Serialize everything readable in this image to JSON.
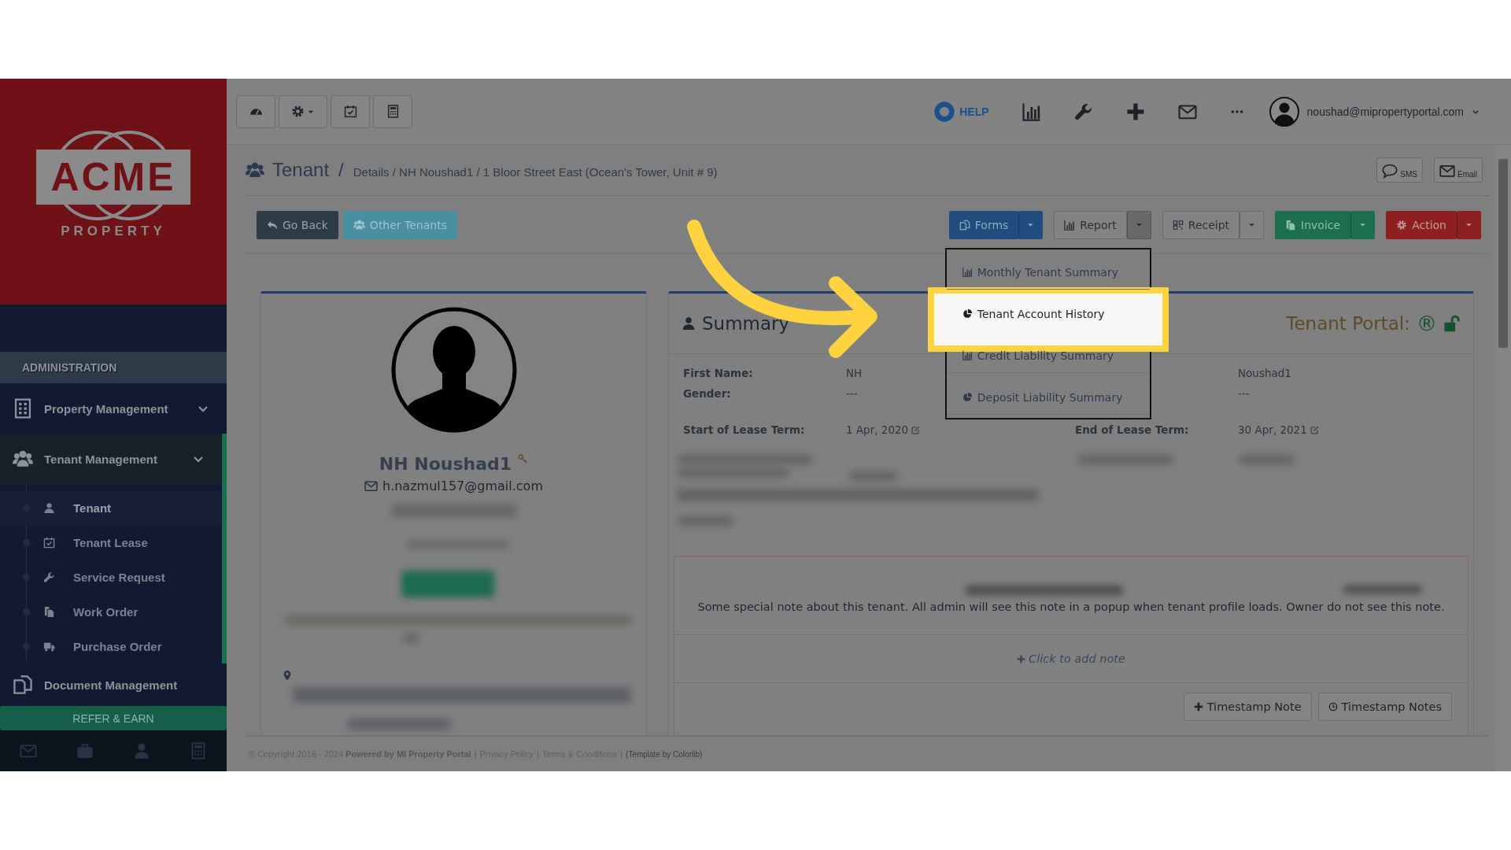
{
  "sidebar": {
    "logo": {
      "name": "ACME",
      "tagline": "PROPERTY"
    },
    "section": "ADMINISTRATION",
    "items": [
      {
        "label": "Property Management",
        "expanded": false
      },
      {
        "label": "Tenant Management",
        "expanded": true,
        "children": [
          {
            "label": "Tenant",
            "selected": true
          },
          {
            "label": "Tenant Lease",
            "selected": false
          },
          {
            "label": "Service Request",
            "selected": false
          },
          {
            "label": "Work Order",
            "selected": false
          },
          {
            "label": "Purchase Order",
            "selected": false
          }
        ]
      },
      {
        "label": "Document Management"
      }
    ],
    "refer": "REFER & EARN"
  },
  "topbar": {
    "help": "HELP",
    "user": "noushad@mipropertyportal.com"
  },
  "header": {
    "title": "Tenant",
    "separator": "/",
    "trail": "Details / NH Noushad1 / 1 Bloor Street East (Ocean's Tower, Unit # 9)",
    "contact_buttons": [
      "SMS",
      "Email"
    ]
  },
  "actions": {
    "left": [
      "Go Back",
      "Other Tenants"
    ],
    "right": [
      {
        "label": "Forms",
        "kind": "primary",
        "open": false
      },
      {
        "label": "Report",
        "kind": "default",
        "open": true
      },
      {
        "label": "Receipt",
        "kind": "default",
        "open": false
      },
      {
        "label": "Invoice",
        "kind": "success",
        "open": false
      },
      {
        "label": "Action",
        "kind": "danger",
        "open": false
      }
    ]
  },
  "report_menu": [
    {
      "label": "Monthly Tenant Summary",
      "selected": false
    },
    {
      "label": "Tenant Account History",
      "selected": true
    },
    {
      "label": "Credit Liability Summary",
      "selected": false
    },
    {
      "label": "Deposit Liability Summary",
      "selected": false
    }
  ],
  "profile": {
    "name": "NH Noushad1",
    "email": "h.nazmul157@gmail.com"
  },
  "summary": {
    "title": "Summary",
    "portal": "Tenant Portal:",
    "portal_mark": "®",
    "fields": [
      {
        "label": "First Name:",
        "value": "NH"
      },
      {
        "label": "Gender:",
        "value": "---"
      }
    ],
    "fields_right": [
      {
        "value": "Noushad1"
      },
      {
        "value": "---"
      }
    ],
    "lease": [
      {
        "label": "Start of Lease Term:",
        "value": "1 Apr, 2020"
      },
      {
        "label": "End of Lease Term:",
        "value": "30 Apr, 2021"
      }
    ]
  },
  "note": {
    "text": "Some special note about this tenant. All admin will see this note in a popup when tenant profile loads. Owner do not see this note.",
    "add": "Click to add note",
    "buttons": [
      "Timestamp Note",
      "Timestamp Notes"
    ]
  },
  "footer": {
    "copyright": "© Copyright 2016 - 2024 **Powered by MI Property Portal**",
    "separator": "|",
    "links": [
      "Privacy Policy",
      "Terms & Conditions"
    ],
    "credit": "(Template by Colorlib)"
  }
}
